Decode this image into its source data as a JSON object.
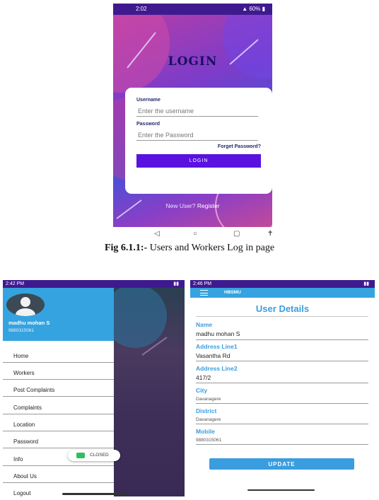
{
  "colors": {
    "status_bar": "#3f1a8f",
    "login_button": "#5a12e0",
    "accent_blue": "#35a3e0",
    "label_blue": "#3a9de0",
    "toast_green": "#2fbf62"
  },
  "login_screen": {
    "status_time": "2:02",
    "status_right": "60%",
    "title": "LOGIN",
    "username_label": "Username",
    "username_placeholder": "Enter the username",
    "password_label": "Password",
    "password_placeholder": "Enter the Password",
    "forgot_password": "Forget Password?",
    "login_button": "LOGIN",
    "new_user_text": "New User?",
    "register_link": "Register",
    "nav_icons": [
      "back-icon",
      "home-icon",
      "recents-icon",
      "accessibility-icon"
    ]
  },
  "caption": {
    "figure": "Fig 6.1.1:-",
    "text": "Users and Workers Log in page"
  },
  "drawer_screen": {
    "status_time": "2:42 PM",
    "user_name": "madhu mohan S",
    "user_phone": "9880315061",
    "menu_items": [
      "Home",
      "Workers",
      "Post Complaints",
      "Complaints",
      "Location",
      "Password",
      "Info",
      "About Us",
      "Logout"
    ],
    "toast_text": "CLOSED"
  },
  "details_screen": {
    "status_time": "2:46 PM",
    "app_title": "HBSMU",
    "page_title": "User Details",
    "fields": [
      {
        "label": "Name",
        "value": "madhu mohan S"
      },
      {
        "label": "Address Line1",
        "value": "Vasantha Rd"
      },
      {
        "label": "Address Line2",
        "value": "417/2"
      },
      {
        "label": "City",
        "value": "Davanagere"
      },
      {
        "label": "District",
        "value": "Davanagere"
      },
      {
        "label": "Mobile",
        "value": "9880315061"
      }
    ],
    "update_button": "UPDATE"
  }
}
